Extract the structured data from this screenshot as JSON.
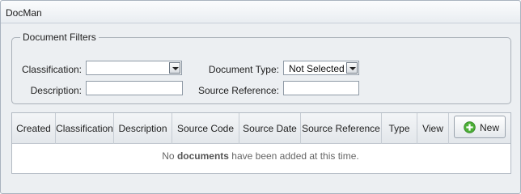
{
  "window": {
    "title": "DocMan"
  },
  "filters": {
    "legend": "Document Filters",
    "classification_label": "Classification:",
    "classification_value": "",
    "document_type_label": "Document Type:",
    "document_type_value": "Not Selected",
    "description_label": "Description:",
    "description_value": "",
    "source_reference_label": "Source Reference:",
    "source_reference_value": ""
  },
  "table": {
    "columns": [
      "Created",
      "Classification",
      "Description",
      "Source Code",
      "Source Date",
      "Source Reference",
      "Type",
      "View"
    ],
    "new_button_label": "New",
    "empty_message_prefix": "No ",
    "empty_message_bold": "documents",
    "empty_message_suffix": " have been added at this time."
  },
  "colors": {
    "accent_green": "#4caf36",
    "background": "#eceff2"
  },
  "icons": {
    "new_button": "plus-circle-icon",
    "select_arrow": "chevron-down-icon"
  }
}
